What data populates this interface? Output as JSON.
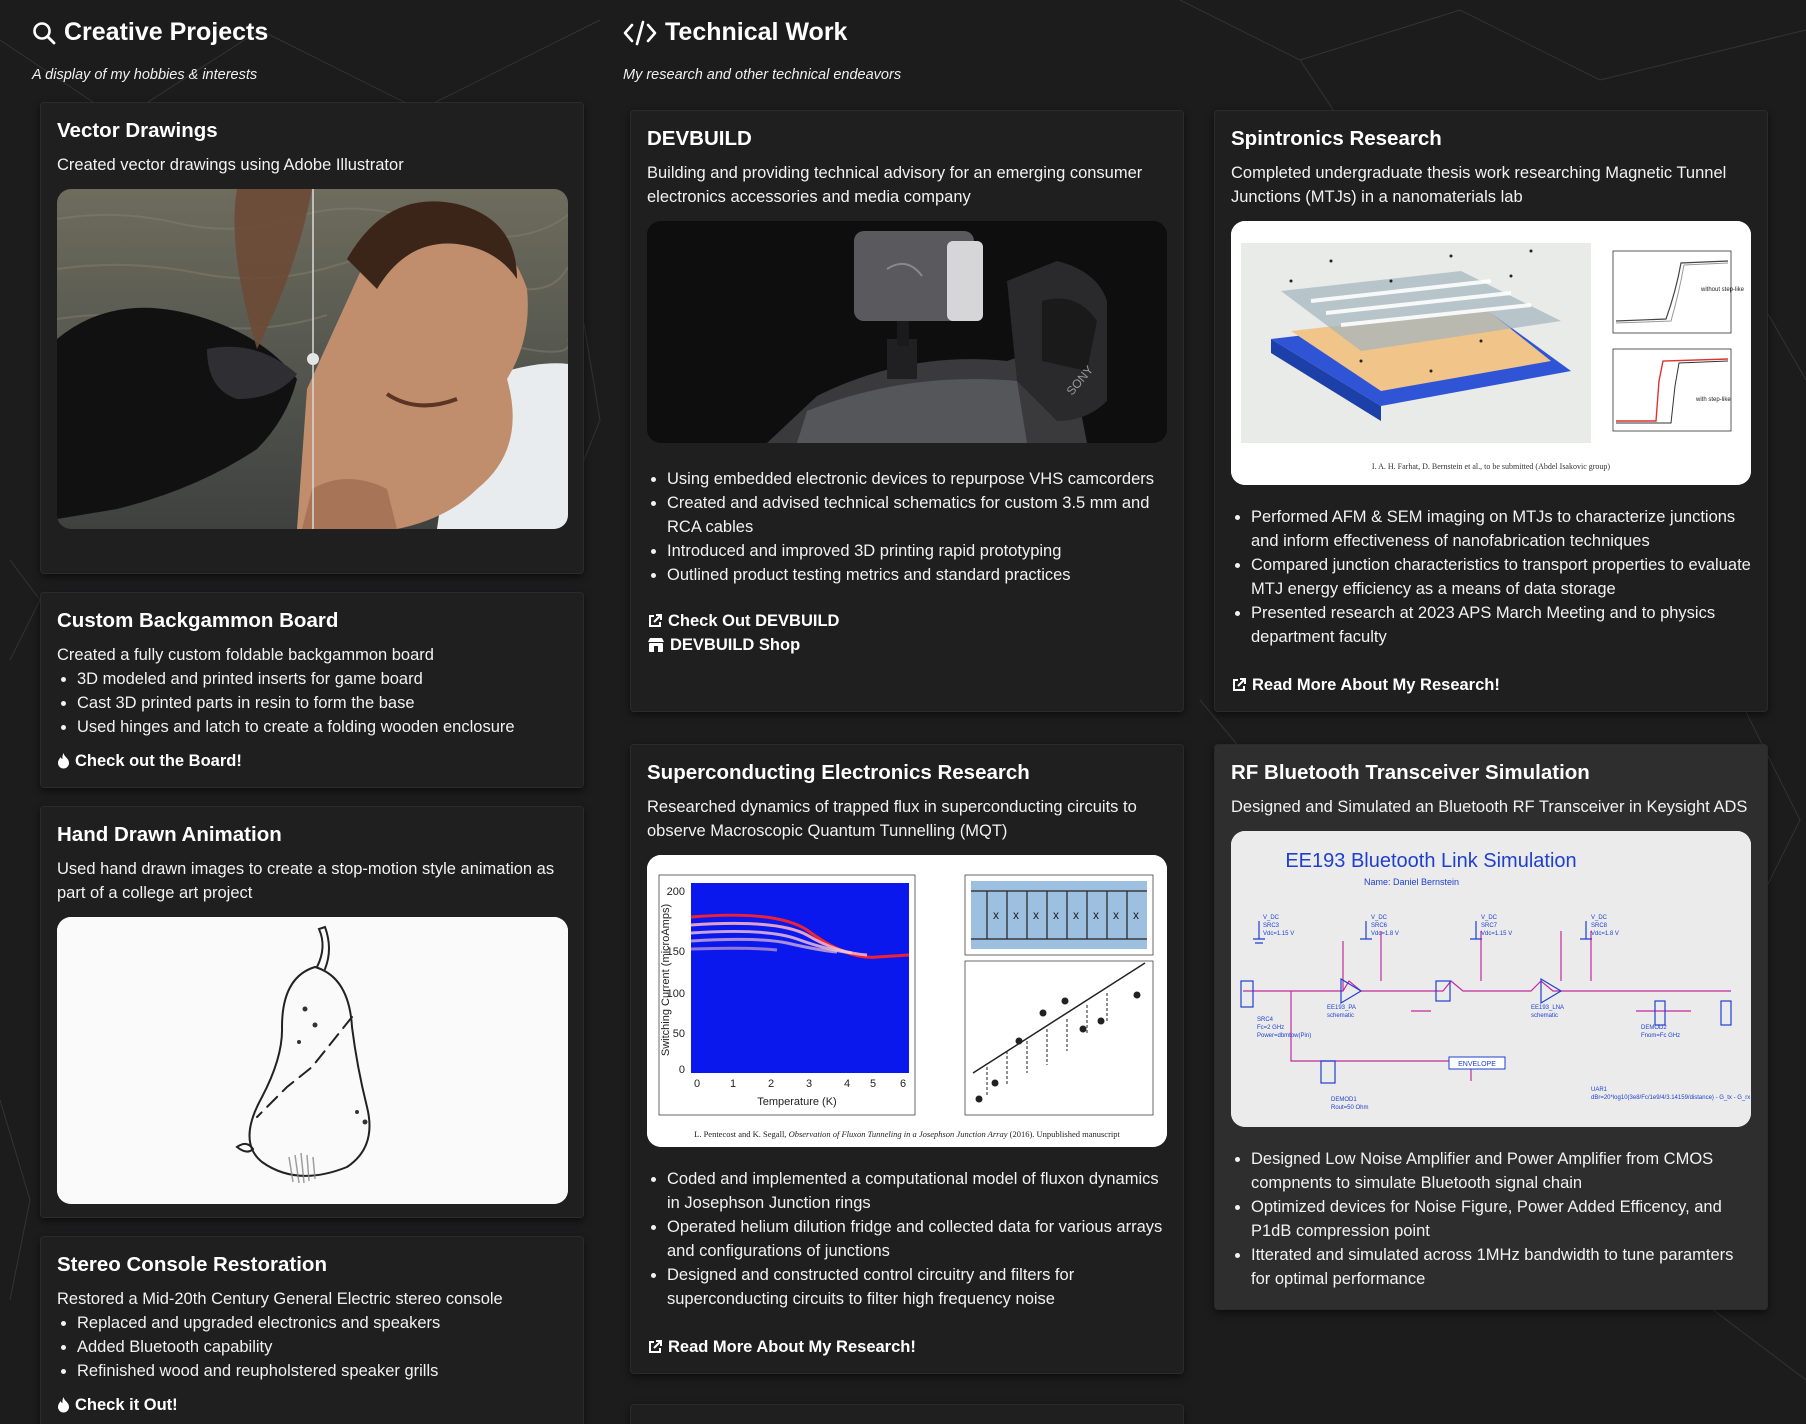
{
  "creative": {
    "title": "Creative Projects",
    "subtitle": "A display of my hobbies & interests",
    "icon": "search-icon",
    "cards": {
      "vector": {
        "title": "Vector Drawings",
        "desc": "Created vector drawings using Adobe Illustrator"
      },
      "backgammon": {
        "title": "Custom Backgammon Board",
        "desc": "Created a fully custom foldable backgammon board",
        "bullets": [
          "3D modeled and printed inserts for game board",
          "Cast 3D printed parts in resin to form the base",
          "Used hinges and latch to create a folding wooden enclosure"
        ],
        "link": "Check out the Board!"
      },
      "animation": {
        "title": "Hand Drawn Animation",
        "desc": "Used hand drawn images to create a stop-motion style animation as part of a college art project"
      },
      "stereo": {
        "title": "Stereo Console Restoration",
        "desc": "Restored a Mid-20th Century General Electric stereo console",
        "bullets": [
          "Replaced and upgraded electronics and speakers",
          "Added Bluetooth capability",
          "Refinished wood and reupholstered speaker grills"
        ],
        "link": "Check it Out!"
      }
    }
  },
  "technical": {
    "title": "Technical Work",
    "subtitle": "My research and other technical endeavors",
    "icon": "code-icon",
    "cards": {
      "devbuild": {
        "title": "DEVBUILD",
        "desc": "Building and providing technical advisory for an emerging consumer electronics accessories and media company",
        "bullets": [
          "Using embedded electronic devices to repurpose VHS camcorders",
          "Created and advised technical schematics for custom 3.5 mm and RCA cables",
          "Introduced and improved 3D printing rapid prototyping",
          "Outlined product testing metrics and standard practices"
        ],
        "link1": "Check Out DEVBUILD",
        "link2": "DEVBUILD Shop"
      },
      "spintronics": {
        "title": "Spintronics Research",
        "desc": "Completed undergraduate thesis work researching Magnetic Tunnel Junctions (MTJs) in a nanomaterials lab",
        "figure_caption": "I. A. H. Farhat, D. Bernstein et al., to be submitted (Abdel Isakovic group)",
        "figure_labels": [
          "without step-like",
          "with step-like"
        ],
        "bullets": [
          "Performed AFM & SEM imaging on MTJs to characterize junctions and inform effectiveness of nanofabrication techniques",
          "Compared junction characteristics to transport properties to evaluate MTJ energy efficiency as a means of data storage",
          "Presented research at 2023 APS March Meeting and to physics department faculty"
        ],
        "link": "Read More About My Research!"
      },
      "superconducting": {
        "title": "Superconducting Electronics Research",
        "desc": "Researched dynamics of trapped flux in superconducting circuits to observe Macroscopic Quantum Tunnelling (MQT)",
        "figure_ylabel": "Switching Current (microAmps)",
        "figure_xlabel": "Temperature (K)",
        "figure_yticks": [
          "0",
          "50",
          "100",
          "150",
          "200"
        ],
        "figure_xticks": [
          "0",
          "1",
          "2",
          "3",
          "4",
          "5",
          "6"
        ],
        "figure_caption_authors": "L. Pentecost and K. Segall,",
        "figure_caption_title": "Observation of Fluxon Tunneling in a Josephson Junction Array",
        "figure_caption_end": "(2016). Unpublished manuscript",
        "bullets": [
          "Coded and implemented a computational model of fluxon dynamics in Josephson Junction rings",
          "Operated helium dilution fridge and collected data for various arrays and configurations of junctions",
          "Designed and constructed control circuitry and filters for superconducting circuits to filter high frequency noise"
        ],
        "link": "Read More About My Research!"
      },
      "rf": {
        "title": "RF Bluetooth Transceiver Simulation",
        "desc": "Designed and Simulated an Bluetooth RF Transceiver in Keysight ADS",
        "schematic_title": "EE193 Bluetooth Link Simulation",
        "schematic_name": "Name:  Daniel Bernstein",
        "schematic_envelope": "ENVELOPE",
        "bullets": [
          "Designed Low Noise Amplifier and Power Amplifier from CMOS compnents to simulate Bluetooth signal chain",
          "Optimized devices for Noise Figure, Power Added Efficency, and P1dB compression point",
          "Itterated and simulated across 1MHz bandwidth to tune paramters for optimal performance"
        ]
      }
    }
  }
}
